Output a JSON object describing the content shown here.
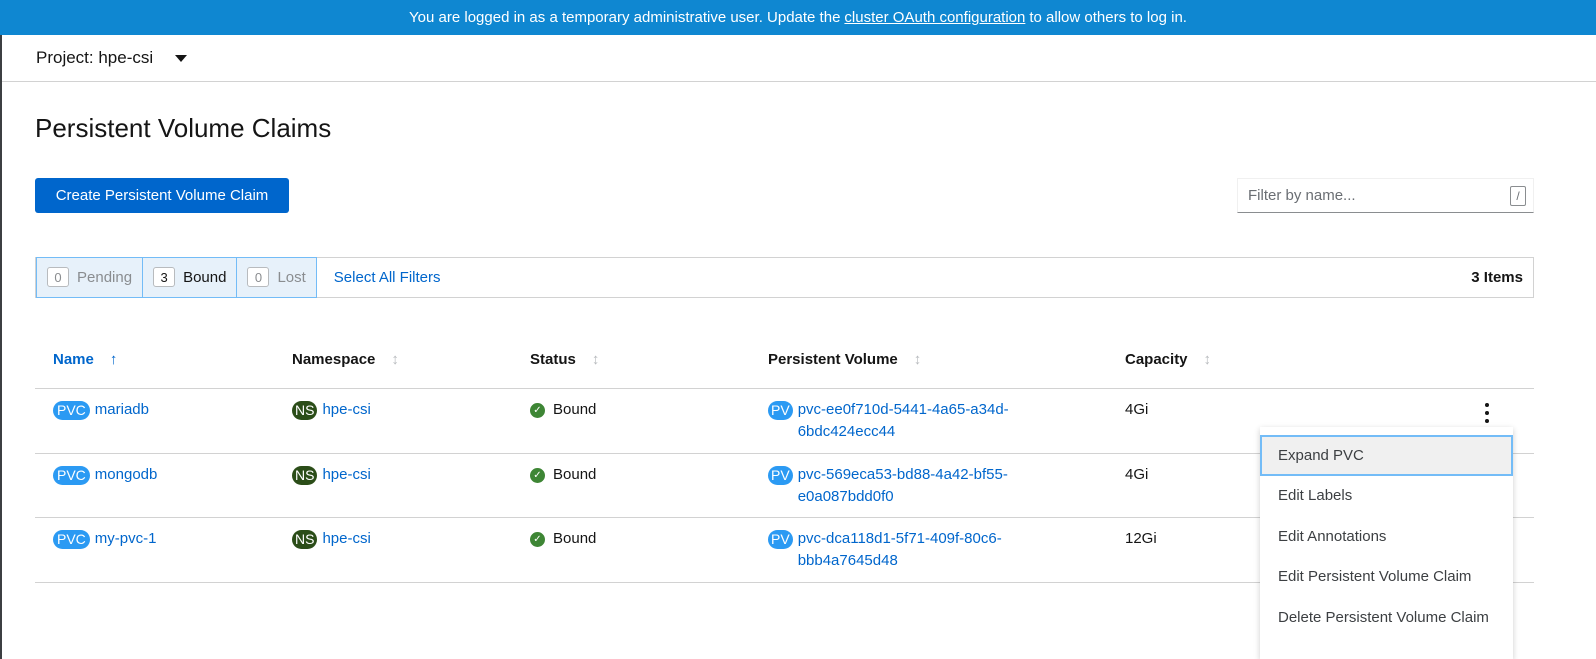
{
  "banner": {
    "text_before": "You are logged in as a temporary administrative user. Update the",
    "link_text": "cluster OAuth configuration",
    "text_after": "to allow others to log in."
  },
  "project": {
    "label": "Project: hpe-csi"
  },
  "page": {
    "title": "Persistent Volume Claims",
    "create_button": "Create Persistent Volume Claim",
    "filter_placeholder": "Filter by name...",
    "filter_shortcut": "/"
  },
  "filters": {
    "statuses": [
      {
        "count": "0",
        "label": "Pending"
      },
      {
        "count": "3",
        "label": "Bound"
      },
      {
        "count": "0",
        "label": "Lost"
      }
    ],
    "select_all": "Select All Filters",
    "items_count": "3 Items"
  },
  "table": {
    "columns": [
      "Name",
      "Namespace",
      "Status",
      "Persistent Volume",
      "Capacity"
    ],
    "rows": [
      {
        "name": "mariadb",
        "name_badge": "PVC",
        "ns_badge": "NS",
        "namespace": "hpe-csi",
        "status": "Bound",
        "pv_badge": "PV",
        "pv_line1": "pvc-ee0f710d-5441-4a65-a34d-",
        "pv_line2": "6bdc424ecc44",
        "capacity": "4Gi"
      },
      {
        "name": "mongodb",
        "name_badge": "PVC",
        "ns_badge": "NS",
        "namespace": "hpe-csi",
        "status": "Bound",
        "pv_badge": "PV",
        "pv_line1": "pvc-569eca53-bd88-4a42-bf55-",
        "pv_line2": "e0a087bdd0f0",
        "capacity": "4Gi"
      },
      {
        "name": "my-pvc-1",
        "name_badge": "PVC",
        "ns_badge": "NS",
        "namespace": "hpe-csi",
        "status": "Bound",
        "pv_badge": "PV",
        "pv_line1": "pvc-dca118d1-5f71-409f-80c6-",
        "pv_line2": "bbb4a7645d48",
        "capacity": "12Gi"
      }
    ]
  },
  "actions_menu": {
    "items": [
      "Expand PVC",
      "Edit Labels",
      "Edit Annotations",
      "Edit Persistent Volume Claim",
      "Delete Persistent Volume Claim"
    ]
  }
}
